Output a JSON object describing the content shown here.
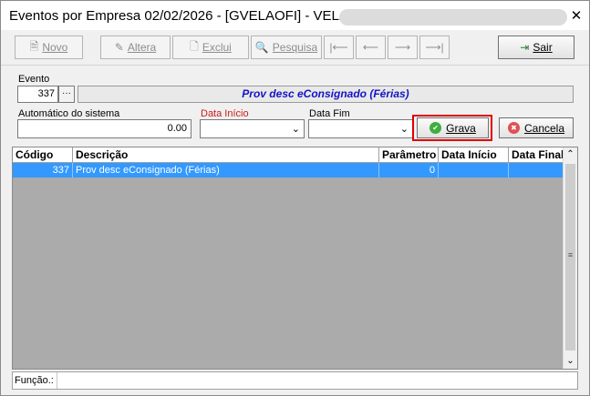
{
  "window": {
    "title": "Eventos por Empresa 02/02/2026 - [GVELAOFI] - VELA",
    "close_glyph": "✕"
  },
  "toolbar": {
    "novo": {
      "label": "Novo",
      "icon": "new-doc-icon"
    },
    "altera": {
      "label": "Altera",
      "icon": "edit-icon"
    },
    "exclui": {
      "label": "Exclui",
      "icon": "delete-icon"
    },
    "pesquisa": {
      "label": "Pesquisa",
      "icon": "search-icon"
    },
    "first": {
      "glyph": "|⟵"
    },
    "prev": {
      "glyph": "⟵"
    },
    "next": {
      "glyph": "⟶"
    },
    "last": {
      "glyph": "⟶|"
    },
    "sair": {
      "label": "Sair",
      "icon": "exit-icon"
    }
  },
  "form": {
    "evento_label": "Evento",
    "evento_code": "337",
    "ellipsis": "···",
    "evento_desc": "Prov desc eConsignado (Férias)",
    "auto_label": "Automático do sistema",
    "auto_value": "0.00",
    "data_inicio_label": "Data Início",
    "data_inicio_value": "",
    "data_fim_label": "Data Fim",
    "data_fim_value": "",
    "grava_label": "Grava",
    "cancela_label": "Cancela",
    "colors": {
      "required_label": "#cc1a1a",
      "desc_text": "#1313c8",
      "highlight": "#e00000",
      "selected_row": "#3399ff"
    }
  },
  "grid": {
    "columns": [
      "Código",
      "Descrição",
      "Parâmetro",
      "Data Início",
      "Data Final"
    ],
    "rows": [
      {
        "codigo": "337",
        "descricao": "Prov desc eConsignado (Férias)",
        "parametro": "0",
        "data_inicio": "",
        "data_final": ""
      }
    ],
    "scroll_up": "⌃",
    "scroll_down": "⌄",
    "scroll_grip": "≡"
  },
  "footer": {
    "funcao_label": "Função.:",
    "funcao_value": ""
  }
}
